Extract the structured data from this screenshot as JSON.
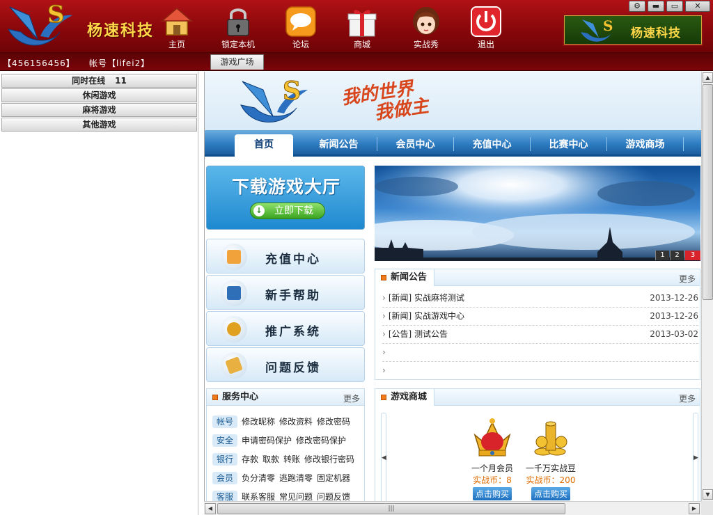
{
  "app": {
    "brand": "杨速科技",
    "window_controls": [
      "⚙",
      "▬",
      "▭",
      "✕"
    ]
  },
  "toolbar": [
    {
      "id": "home",
      "label": "主页",
      "icon": "house-icon"
    },
    {
      "id": "lock",
      "label": "锁定本机",
      "icon": "padlock-icon"
    },
    {
      "id": "forum",
      "label": "论坛",
      "icon": "speech-bubble-icon"
    },
    {
      "id": "shop",
      "label": "商城",
      "icon": "gift-box-icon"
    },
    {
      "id": "show",
      "label": "实战秀",
      "icon": "avatar-girl-icon"
    },
    {
      "id": "exit",
      "label": "退出",
      "icon": "power-icon"
    }
  ],
  "user": {
    "id_text": "【456156456】",
    "account_text": "帐号【lifei2】"
  },
  "tabs": {
    "plaza": "游戏广场"
  },
  "left_tree": {
    "online_label": "同时在线",
    "online_count": "11",
    "groups": [
      "休闲游戏",
      "麻将游戏",
      "其他游戏"
    ]
  },
  "portal": {
    "slogan_line1": "我的世界",
    "slogan_line2": "我做主",
    "nav": [
      "首页",
      "新闻公告",
      "会员中心",
      "充值中心",
      "比赛中心",
      "游戏商场"
    ],
    "download": {
      "title": "下载游戏大厅",
      "button": "立即下载"
    },
    "menu": [
      {
        "label": "充值中心",
        "icon": "recharge-icon",
        "color": "#f2a23a"
      },
      {
        "label": "新手帮助",
        "icon": "help-book-icon",
        "color": "#2f6fb8"
      },
      {
        "label": "推广系统",
        "icon": "promotion-icon",
        "color": "#e0a020"
      },
      {
        "label": "问题反馈",
        "icon": "feedback-icon",
        "color": "#e8b040"
      }
    ],
    "slideshow": {
      "pages": [
        "1",
        "2",
        "3"
      ],
      "active": "3"
    },
    "news": {
      "title": "新闻公告",
      "more": "更多",
      "items": [
        {
          "text": "[新闻] 实战麻将测试",
          "date": "2013-12-26"
        },
        {
          "text": "[新闻] 实战游戏中心",
          "date": "2013-12-26"
        },
        {
          "text": "[公告] 测试公告",
          "date": "2013-03-02"
        },
        {
          "text": "",
          "date": ""
        },
        {
          "text": "",
          "date": ""
        }
      ]
    },
    "service": {
      "title": "服务中心",
      "more": "更多",
      "rows": [
        {
          "tag": "帐号",
          "links": [
            "修改昵称",
            "修改资料",
            "修改密码"
          ]
        },
        {
          "tag": "安全",
          "links": [
            "申请密码保护",
            "修改密码保护"
          ]
        },
        {
          "tag": "银行",
          "links": [
            "存款",
            "取款",
            "转账",
            "修改银行密码"
          ]
        },
        {
          "tag": "会员",
          "links": [
            "负分清零",
            "逃跑清零",
            "固定机器"
          ]
        },
        {
          "tag": "客服",
          "links": [
            "联系客服",
            "常见问题",
            "问题反馈"
          ]
        }
      ]
    },
    "shop": {
      "title": "游戏商城",
      "more": "更多",
      "items": [
        {
          "name": "一个月会员",
          "price": "实战币：8",
          "buy": "点击购买",
          "icon": "crown-icon"
        },
        {
          "name": "一千万实战豆",
          "price": "实战币：200",
          "buy": "点击购买",
          "icon": "gold-coins-icon"
        }
      ]
    }
  }
}
